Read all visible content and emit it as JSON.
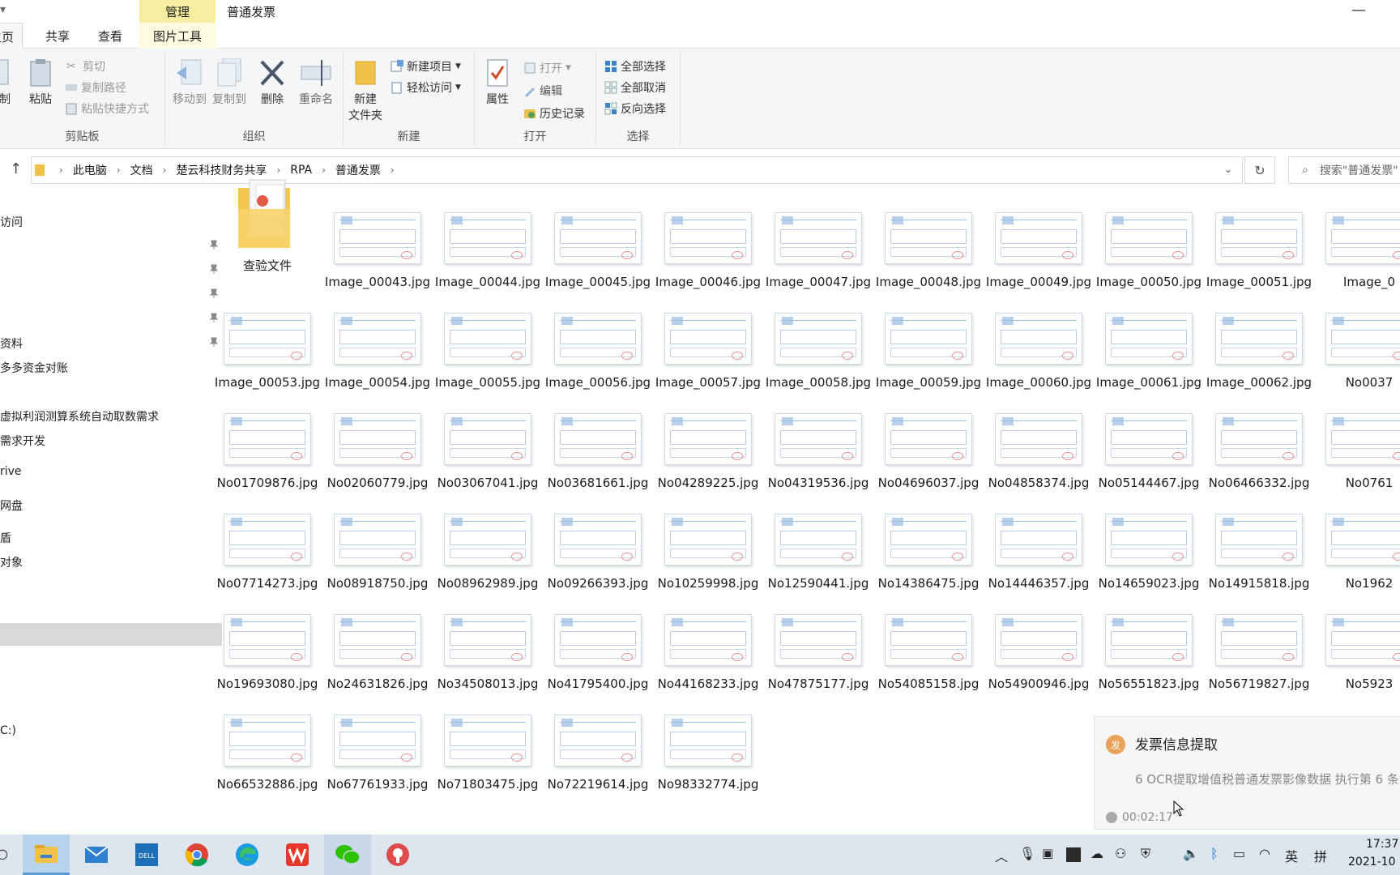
{
  "titlebar": {
    "manage_tab": "管理",
    "window_title": "普通发票",
    "left_glyph": "▾",
    "minimize_label": "—"
  },
  "ribbon_tabs": {
    "home": "主页",
    "share": "共享",
    "view": "查看",
    "picture_tools": "图片工具"
  },
  "ribbon": {
    "clipboard": {
      "label": "剪贴板",
      "copy": "制",
      "paste": "粘贴",
      "cut": "剪切",
      "copy_path": "复制路径",
      "paste_shortcut": "粘贴快捷方式"
    },
    "organize": {
      "label": "组织",
      "move_to": "移动到",
      "copy_to": "复制到",
      "delete": "删除",
      "rename": "重命名"
    },
    "new": {
      "label": "新建",
      "new_folder_line1": "新建",
      "new_folder_line2": "文件夹",
      "new_item": "新建项目",
      "easy_access": "轻松访问"
    },
    "open": {
      "label": "打开",
      "properties": "属性",
      "open": "打开",
      "edit": "编辑",
      "history": "历史记录"
    },
    "select": {
      "label": "选择",
      "select_all": "全部选择",
      "select_none": "全部取消",
      "invert": "反向选择"
    }
  },
  "address": {
    "crumbs": [
      "此电脑",
      "文档",
      "楚云科技财务共享",
      "RPA",
      "普通发票"
    ],
    "search_placeholder": "搜索\"普通发票\""
  },
  "navpane": {
    "items": [
      "访问",
      "资料",
      "多多资金对账",
      "虚拟利润测算系统自动取数需求",
      "需求开发",
      "rive",
      "网盘",
      "盾",
      "对象",
      "C:)"
    ]
  },
  "files": [
    "查验文件",
    "Image_00043.jpg",
    "Image_00044.jpg",
    "Image_00045.jpg",
    "Image_00046.jpg",
    "Image_00047.jpg",
    "Image_00048.jpg",
    "Image_00049.jpg",
    "Image_00050.jpg",
    "Image_00051.jpg",
    "Image_0",
    "Image_00053.jpg",
    "Image_00054.jpg",
    "Image_00055.jpg",
    "Image_00056.jpg",
    "Image_00057.jpg",
    "Image_00058.jpg",
    "Image_00059.jpg",
    "Image_00060.jpg",
    "Image_00061.jpg",
    "Image_00062.jpg",
    "No0037",
    "No01709876.jpg",
    "No02060779.jpg",
    "No03067041.jpg",
    "No03681661.jpg",
    "No04289225.jpg",
    "No04319536.jpg",
    "No04696037.jpg",
    "No04858374.jpg",
    "No05144467.jpg",
    "No06466332.jpg",
    "No0761",
    "No07714273.jpg",
    "No08918750.jpg",
    "No08962989.jpg",
    "No09266393.jpg",
    "No10259998.jpg",
    "No12590441.jpg",
    "No14386475.jpg",
    "No14446357.jpg",
    "No14659023.jpg",
    "No14915818.jpg",
    "No1962",
    "No19693080.jpg",
    "No24631826.jpg",
    "No34508013.jpg",
    "No41795400.jpg",
    "No44168233.jpg",
    "No47875177.jpg",
    "No54085158.jpg",
    "No54900946.jpg",
    "No56551823.jpg",
    "No56719827.jpg",
    "No5923",
    "No66532886.jpg",
    "No67761933.jpg",
    "No71803475.jpg",
    "No72219614.jpg",
    "No98332774.jpg"
  ],
  "toast": {
    "badge": "发",
    "title": "发票信息提取",
    "body": "6 OCR提取增值税普通发票影像数据 执行第 6 条",
    "time": "00:02:17"
  },
  "taskbar": {
    "apps": [
      "file-explorer",
      "mail",
      "dell",
      "chrome",
      "edge",
      "wps",
      "wechat",
      "rpa-app"
    ],
    "ime": "英",
    "ime_mode": "拼",
    "time": "17:37",
    "date": "2021-10"
  },
  "colors": {
    "manage_tab_bg": "#f5eea0",
    "ribbon_bg": "#f5f6f7",
    "taskbar_bg": "#dde6ef",
    "toast_badge": "#e9a258"
  }
}
